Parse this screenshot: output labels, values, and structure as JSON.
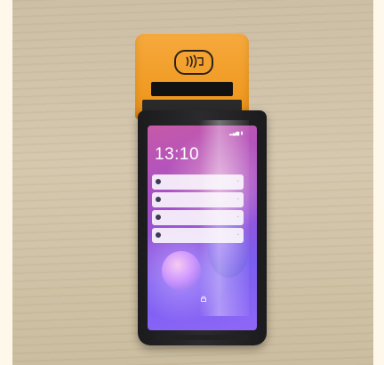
{
  "lockscreen": {
    "time": "13:10"
  },
  "icons": {
    "nfc": "contactless-icon",
    "lock": "lock-icon"
  },
  "colors": {
    "printer_orange": "#f09a22",
    "device_body": "#1b1b1d",
    "wallpaper_purple": "#7b5ef0"
  }
}
